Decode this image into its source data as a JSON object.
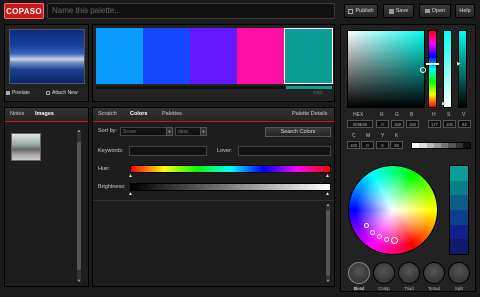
{
  "header": {
    "logo": "COPASO",
    "name_placeholder": "Name this palette...",
    "buttons": {
      "publish": "Publish",
      "save": "Save",
      "open": "Open",
      "help": "Help"
    }
  },
  "image_panel": {
    "pixelate": "Pixelate",
    "attach_new": "Attach New"
  },
  "palette": {
    "swatches": [
      "#0a9bff",
      "#1648ff",
      "#6319ff",
      "#ff0fa0",
      "#0a9e96"
    ],
    "zoom_icons": "▭▭"
  },
  "left_tabs": {
    "notes": "Notes",
    "images": "Images"
  },
  "center_tabs": {
    "scratch": "Scratch",
    "colors": "Colors",
    "palettes": "Palettes",
    "details": "Palette Details"
  },
  "search": {
    "sort_by_label": "Sort by:",
    "sort_value": "Score",
    "order_value": "desc",
    "search_button": "Search Colors",
    "keywords_label": "Keywords:",
    "lover_label": "Lover:",
    "hue_label": "Hue:",
    "brightness_label": "Brightness:"
  },
  "color_values": {
    "hex_label": "HEX",
    "r_label": "R",
    "g_label": "G",
    "b_label": "B",
    "h_label": "H",
    "s_label": "S",
    "v_label": "V",
    "hex": "009E96",
    "r": "0",
    "g": "158",
    "b": "150",
    "h": "177",
    "s": "100",
    "v": "62",
    "c_label": "C",
    "m_label": "M",
    "y_label": "Y",
    "k_label": "K",
    "c": "100",
    "m": "0",
    "y": "5",
    "k": "38"
  },
  "swatch_column": [
    "#0a9e96",
    "#0a7f8a",
    "#0b5f87",
    "#0d3f8a",
    "#12208c",
    "#0e1a6a"
  ],
  "harmony_modes": {
    "blend": "Blend",
    "comp": "Comp",
    "triad": "Triad",
    "tetrad": "Tetrad",
    "split": "Split"
  }
}
